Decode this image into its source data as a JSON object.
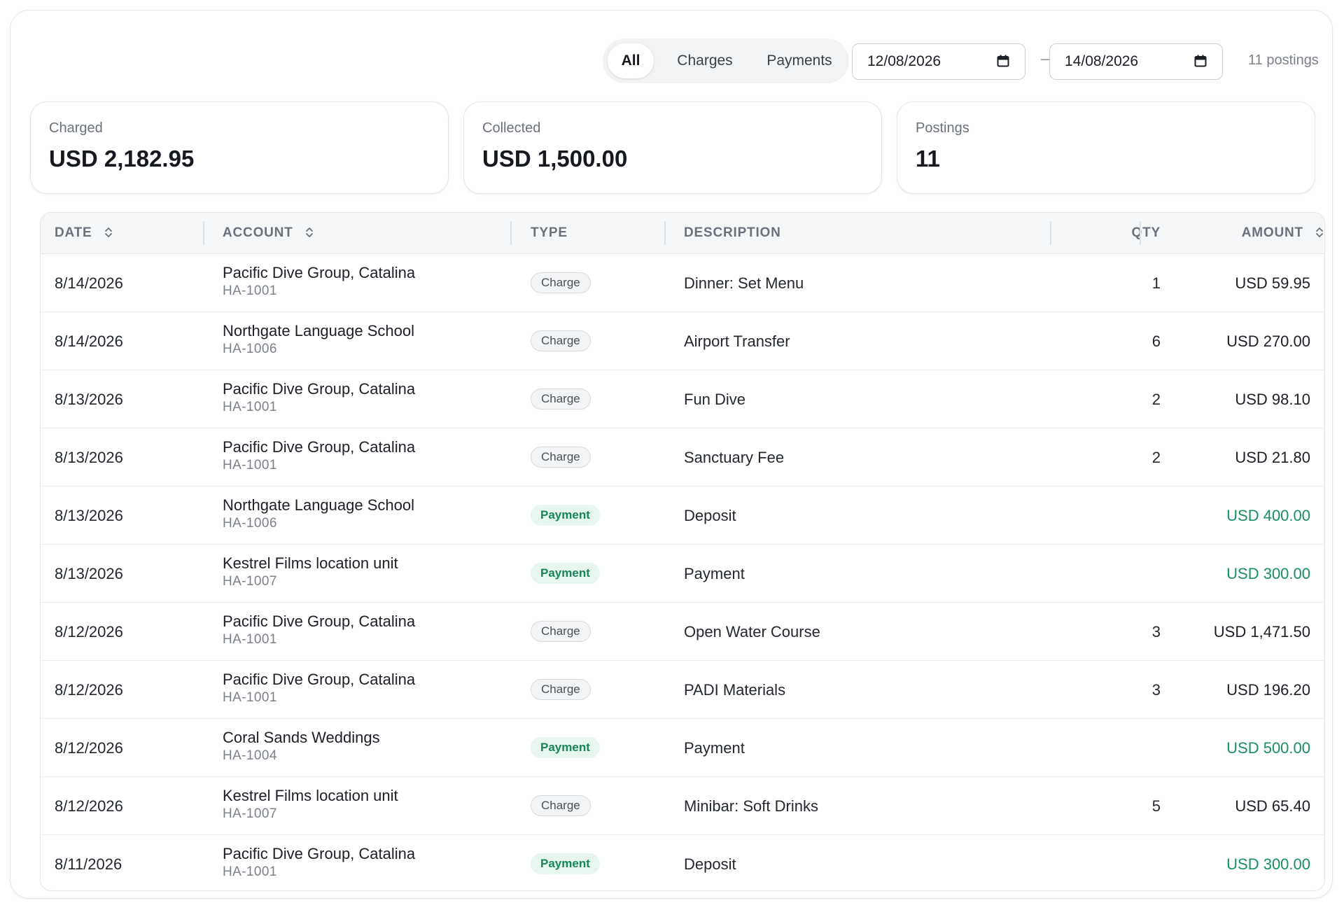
{
  "filters": {
    "tabs": [
      {
        "label": "All",
        "active": true
      },
      {
        "label": "Charges",
        "active": false
      },
      {
        "label": "Payments",
        "active": false
      }
    ],
    "date_from": "12/08/2026",
    "date_separator": "–",
    "date_to": "14/08/2026",
    "count_label": "11 postings"
  },
  "summary": {
    "charged": {
      "label": "Charged",
      "value": "USD 2,182.95"
    },
    "collected": {
      "label": "Collected",
      "value": "USD 1,500.00"
    },
    "postings": {
      "label": "Postings",
      "value": "11"
    }
  },
  "table": {
    "columns": {
      "date": "DATE",
      "account": "ACCOUNT",
      "type": "TYPE",
      "description": "DESCRIPTION",
      "qty": "QTY",
      "amount": "AMOUNT"
    },
    "rows": [
      {
        "date": "8/14/2026",
        "account": "Pacific Dive Group, Catalina",
        "account_id": "HA-1001",
        "type": "Charge",
        "description": "Dinner: Set Menu",
        "qty": "1",
        "amount": "USD 59.95"
      },
      {
        "date": "8/14/2026",
        "account": "Northgate Language School",
        "account_id": "HA-1006",
        "type": "Charge",
        "description": "Airport Transfer",
        "qty": "6",
        "amount": "USD 270.00"
      },
      {
        "date": "8/13/2026",
        "account": "Pacific Dive Group, Catalina",
        "account_id": "HA-1001",
        "type": "Charge",
        "description": "Fun Dive",
        "qty": "2",
        "amount": "USD 98.10"
      },
      {
        "date": "8/13/2026",
        "account": "Pacific Dive Group, Catalina",
        "account_id": "HA-1001",
        "type": "Charge",
        "description": "Sanctuary Fee",
        "qty": "2",
        "amount": "USD 21.80"
      },
      {
        "date": "8/13/2026",
        "account": "Northgate Language School",
        "account_id": "HA-1006",
        "type": "Payment",
        "description": "Deposit",
        "qty": "",
        "amount": "USD 400.00"
      },
      {
        "date": "8/13/2026",
        "account": "Kestrel Films location unit",
        "account_id": "HA-1007",
        "type": "Payment",
        "description": "Payment",
        "qty": "",
        "amount": "USD 300.00"
      },
      {
        "date": "8/12/2026",
        "account": "Pacific Dive Group, Catalina",
        "account_id": "HA-1001",
        "type": "Charge",
        "description": "Open Water Course",
        "qty": "3",
        "amount": "USD 1,471.50"
      },
      {
        "date": "8/12/2026",
        "account": "Pacific Dive Group, Catalina",
        "account_id": "HA-1001",
        "type": "Charge",
        "description": "PADI Materials",
        "qty": "3",
        "amount": "USD 196.20"
      },
      {
        "date": "8/12/2026",
        "account": "Coral Sands Weddings",
        "account_id": "HA-1004",
        "type": "Payment",
        "description": "Payment",
        "qty": "",
        "amount": "USD 500.00"
      },
      {
        "date": "8/12/2026",
        "account": "Kestrel Films location unit",
        "account_id": "HA-1007",
        "type": "Charge",
        "description": "Minibar: Soft Drinks",
        "qty": "5",
        "amount": "USD 65.40"
      },
      {
        "date": "8/11/2026",
        "account": "Pacific Dive Group, Catalina",
        "account_id": "HA-1001",
        "type": "Payment",
        "description": "Deposit",
        "qty": "",
        "amount": "USD 300.00"
      }
    ]
  },
  "colors": {
    "payment_text": "#17905f",
    "payment_badge_bg": "#e7f6ee",
    "charge_badge_bg": "#f3f4f6",
    "border": "#e3e5e9"
  },
  "icons": {
    "sort": "sort-arrows-icon",
    "calendar": "calendar-icon"
  }
}
